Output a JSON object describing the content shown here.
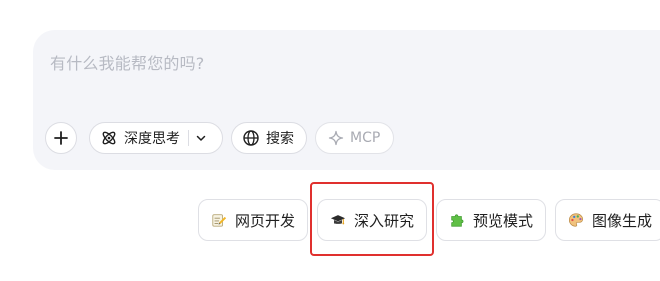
{
  "input": {
    "placeholder": "有什么我能帮您的吗?"
  },
  "toolbar": {
    "add_icon": "plus-icon",
    "deep_think": {
      "label": "深度思考",
      "icon": "atom-icon",
      "dropdown_icon": "chevron-down-icon"
    },
    "search": {
      "label": "搜索",
      "icon": "globe-icon"
    },
    "mcp": {
      "label": "MCP",
      "icon": "sparkle-icon",
      "state": "disabled"
    }
  },
  "suggestions": [
    {
      "label": "网页开发",
      "icon": "pencil-memo-icon"
    },
    {
      "label": "深入研究",
      "icon": "graduation-cap-icon"
    },
    {
      "label": "预览模式",
      "icon": "puzzle-icon"
    },
    {
      "label": "图像生成",
      "icon": "palette-icon"
    }
  ],
  "colors": {
    "accent_highlight": "#e0302e",
    "panel_background": "#f4f5f9",
    "placeholder_text": "#b7bac3"
  }
}
